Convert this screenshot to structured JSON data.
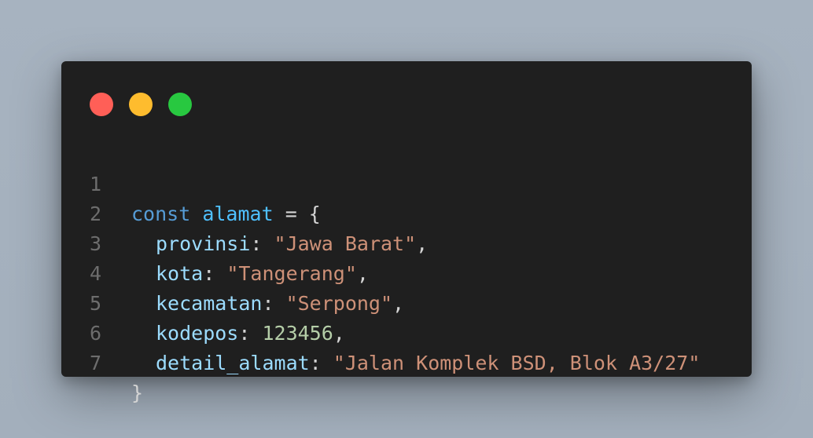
{
  "window": {
    "controls": [
      {
        "name": "close",
        "color": "#ff5f57"
      },
      {
        "name": "minimize",
        "color": "#febc2e"
      },
      {
        "name": "maximize",
        "color": "#28c840"
      }
    ]
  },
  "code": {
    "lines": [
      {
        "number": "1",
        "keyword": "const",
        "identifier": "alamat",
        "operator": " = {"
      },
      {
        "number": "2",
        "property": "provinsi",
        "colon": ": ",
        "value": "\"Jawa Barat\"",
        "trail": ","
      },
      {
        "number": "3",
        "property": "kota",
        "colon": ": ",
        "value": "\"Tangerang\"",
        "trail": ","
      },
      {
        "number": "4",
        "property": "kecamatan",
        "colon": ": ",
        "value": "\"Serpong\"",
        "trail": ","
      },
      {
        "number": "5",
        "property": "kodepos",
        "colon": ": ",
        "value": "123456",
        "trail": ","
      },
      {
        "number": "6",
        "property": "detail_alamat",
        "colon": ": ",
        "value": "\"Jalan Komplek BSD, Blok A3/27\"",
        "trail": ""
      },
      {
        "number": "7",
        "closing": "}"
      }
    ]
  }
}
